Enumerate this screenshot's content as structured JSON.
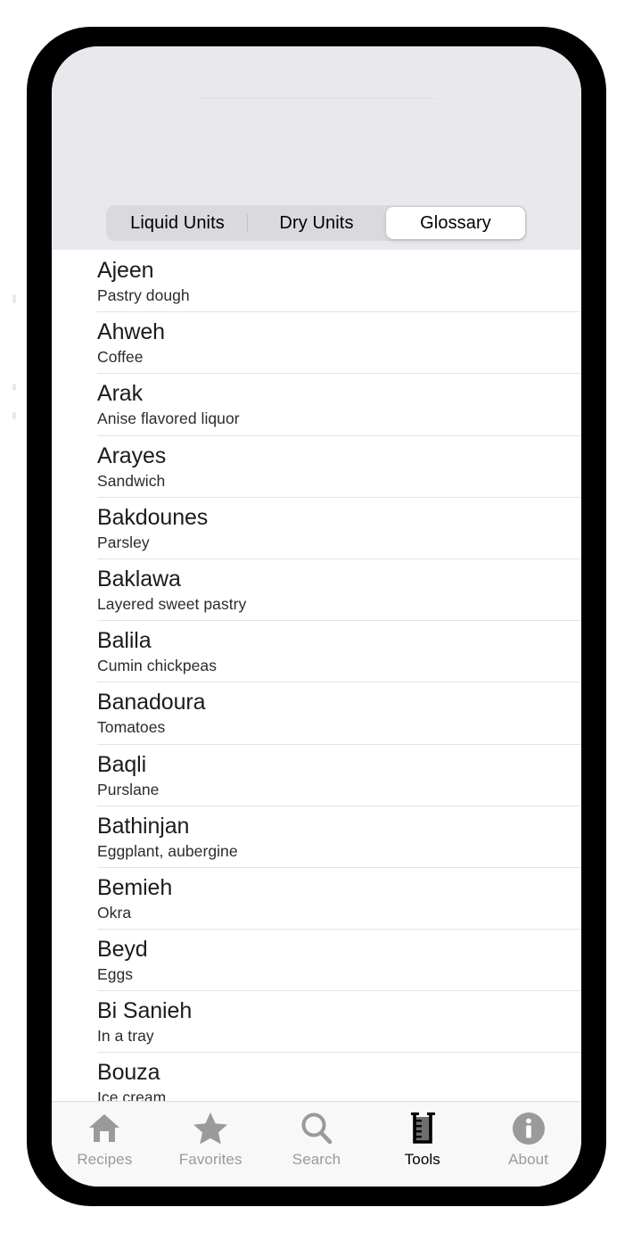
{
  "app": {
    "active_tool_tab": "Glossary"
  },
  "segmented_control": {
    "options": [
      {
        "label": "Liquid Units",
        "selected": false
      },
      {
        "label": "Dry Units",
        "selected": false
      },
      {
        "label": "Glossary",
        "selected": true
      }
    ]
  },
  "glossary": {
    "entries": [
      {
        "term": "Ajeen",
        "definition": "Pastry dough"
      },
      {
        "term": "Ahweh",
        "definition": "Coffee"
      },
      {
        "term": "Arak",
        "definition": "Anise flavored liquor"
      },
      {
        "term": "Arayes",
        "definition": "Sandwich"
      },
      {
        "term": "Bakdounes",
        "definition": "Parsley"
      },
      {
        "term": "Baklawa",
        "definition": "Layered sweet pastry"
      },
      {
        "term": "Balila",
        "definition": "Cumin chickpeas"
      },
      {
        "term": "Banadoura",
        "definition": "Tomatoes"
      },
      {
        "term": "Baqli",
        "definition": "Purslane"
      },
      {
        "term": "Bathinjan",
        "definition": "Eggplant, aubergine"
      },
      {
        "term": "Bemieh",
        "definition": "Okra"
      },
      {
        "term": "Beyd",
        "definition": "Eggs"
      },
      {
        "term": "Bi Sanieh",
        "definition": "In a tray"
      },
      {
        "term": "Bouza",
        "definition": "Ice cream"
      }
    ]
  },
  "tab_bar": {
    "items": [
      {
        "label": "Recipes",
        "icon": "house-icon",
        "active": false
      },
      {
        "label": "Favorites",
        "icon": "star-icon",
        "active": false
      },
      {
        "label": "Search",
        "icon": "magnifier-icon",
        "active": false
      },
      {
        "label": "Tools",
        "icon": "beaker-icon",
        "active": true
      },
      {
        "label": "About",
        "icon": "info-circle-icon",
        "active": false
      }
    ]
  },
  "colors": {
    "inactive_tab": "#9a9a9a",
    "active_tab": "#000000",
    "nav_background": "#e8e8ed",
    "segment_track": "#d9d9de",
    "segment_selected": "#ffffff",
    "separator": "#e3e3e6"
  }
}
